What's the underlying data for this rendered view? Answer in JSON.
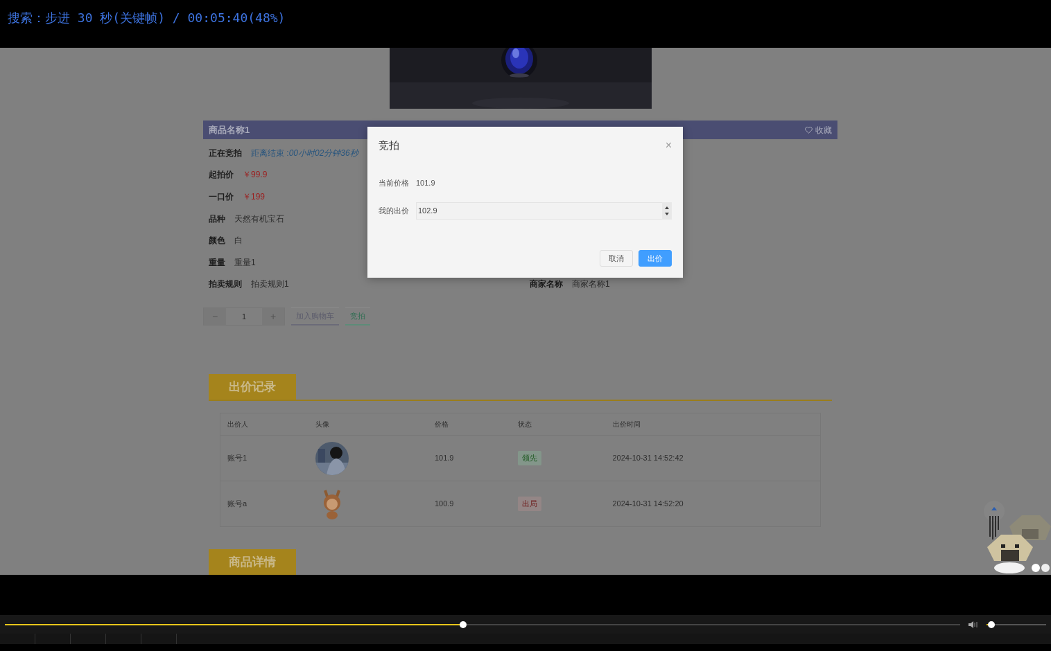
{
  "osd": {
    "text": "搜索：步进 30 秒(关键帧) / 00:05:40(48%)"
  },
  "product": {
    "title": "商品名称1",
    "favorite": "收藏",
    "details": [
      {
        "kind": "countdown",
        "label": "正在竞拍",
        "value": "距离结束 :*00小时02分钟36秒*"
      },
      {
        "kind": "price",
        "label": "起拍价",
        "value": "￥99.9"
      },
      {
        "kind": "price",
        "label": "一口价",
        "value": "￥199"
      },
      {
        "kind": "plain",
        "label": "品种",
        "value": "天然有机宝石"
      },
      {
        "kind": "plain",
        "label": "颜色",
        "value": "白"
      },
      {
        "kind": "plain",
        "label": "重量",
        "value": "重量1"
      },
      {
        "kind": "plain",
        "label": "拍卖规则",
        "value": "拍卖规则1"
      }
    ],
    "merchant": {
      "label": "商家名称",
      "value": "商家名称1"
    },
    "quantity": {
      "decrement": "−",
      "value": "1",
      "increment": "+"
    },
    "buttons": [
      {
        "kind": "cart",
        "label": "加入购物车"
      },
      {
        "kind": "bid",
        "label": "竞拍"
      }
    ]
  },
  "bid_records": {
    "title": "出价记录",
    "columns": [
      "出价人",
      "头像",
      "价格",
      "状态",
      "出价时间"
    ],
    "rows": [
      {
        "bidder": "账号1",
        "price": "101.9",
        "status": {
          "text": "领先",
          "kind": "leading"
        },
        "time": "2024-10-31 14:52:42"
      },
      {
        "bidder": "账号a",
        "avatar": {
          "kind": "cartoon"
        },
        "price": "100.9",
        "status": {
          "text": "出局",
          "kind": "out"
        },
        "time": "2024-10-31 14:52:20"
      }
    ]
  },
  "next_section": {
    "title": "商品详情"
  },
  "dialog": {
    "title": "竞拍",
    "close": "×",
    "current_label": "当前价格",
    "current_value": "101.9",
    "bid_label": "我的出价",
    "bid_value": "102.9",
    "buttons": [
      {
        "kind": "cancel",
        "label": "取消"
      },
      {
        "kind": "confirm",
        "label": "出价"
      }
    ]
  },
  "player": {
    "progress": {
      "level": 0.48
    },
    "volume": {
      "level": 0.08
    }
  }
}
